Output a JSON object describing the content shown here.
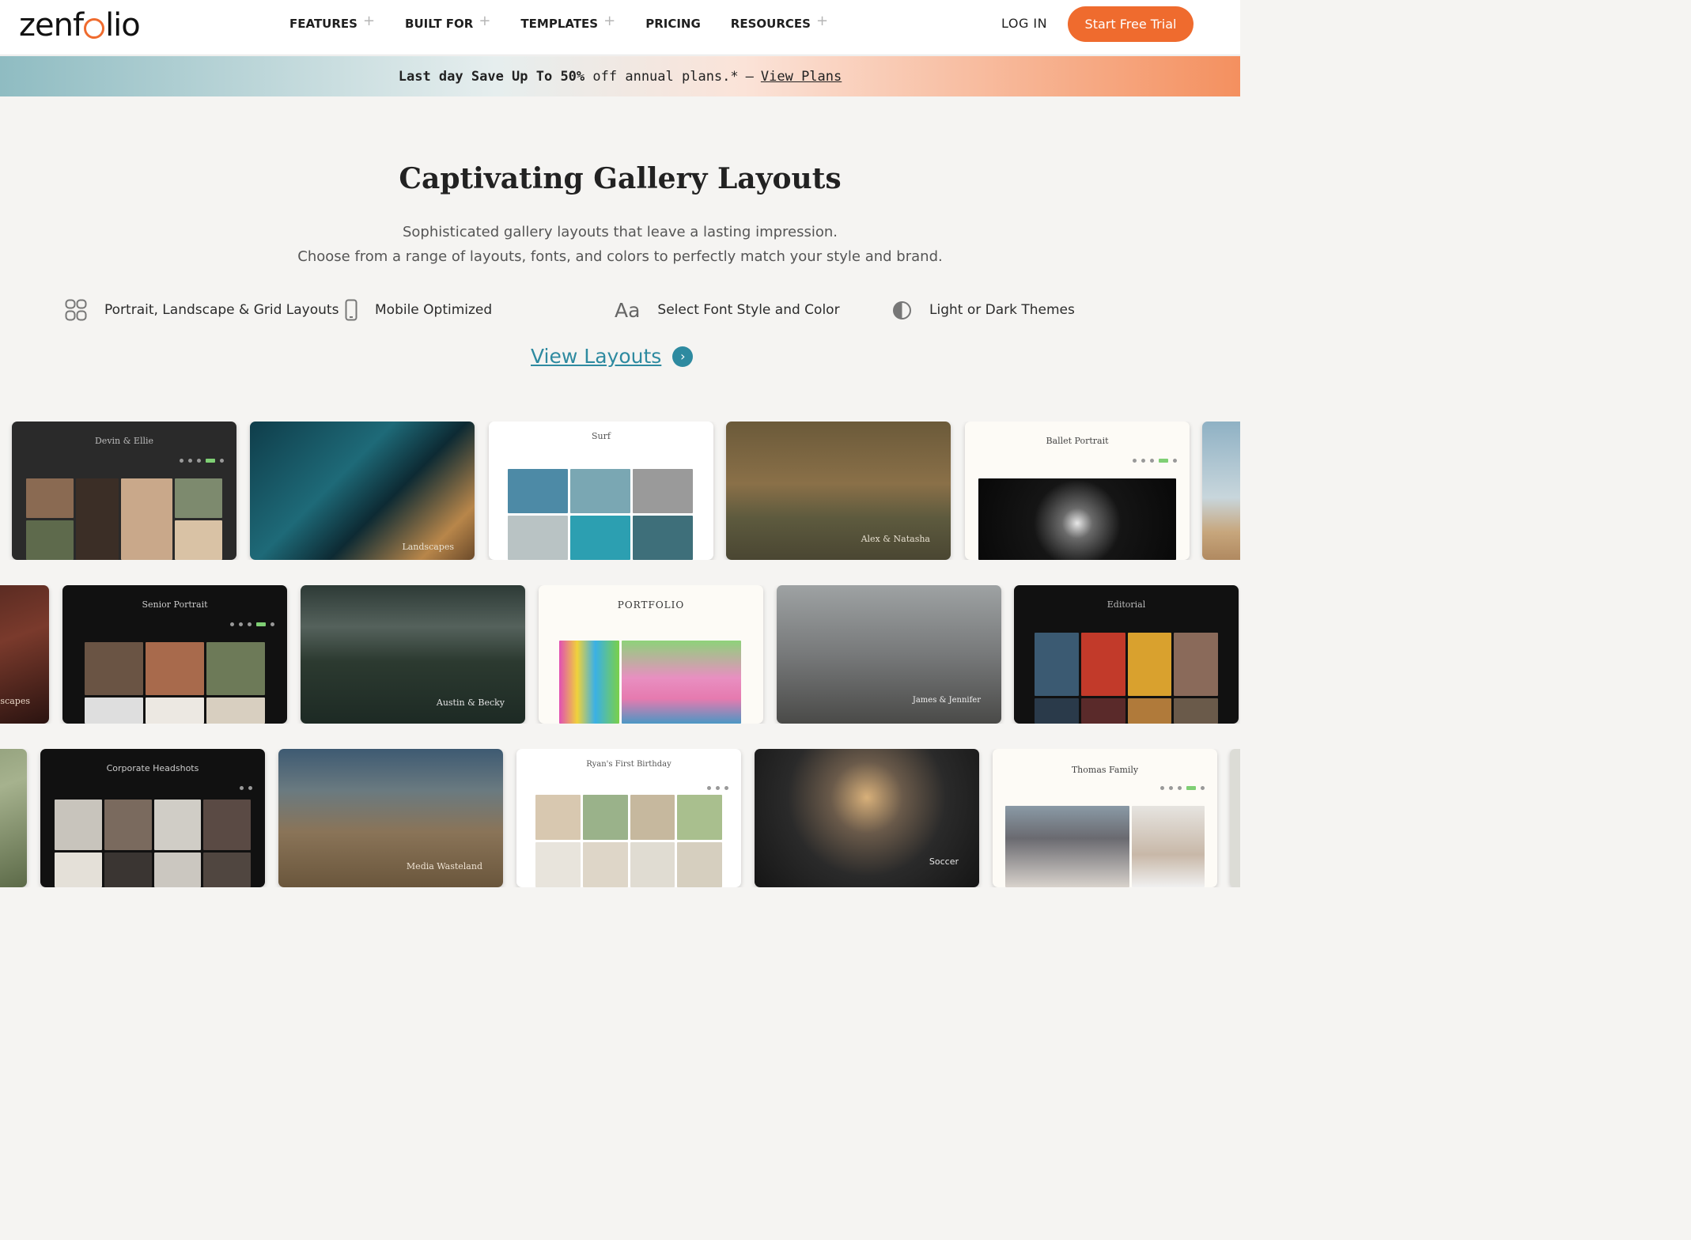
{
  "header": {
    "logo_text": "zenfolio",
    "nav": [
      {
        "label": "FEATURES",
        "has_plus": true
      },
      {
        "label": "BUILT FOR",
        "has_plus": true
      },
      {
        "label": "TEMPLATES",
        "has_plus": true
      },
      {
        "label": "PRICING",
        "has_plus": false
      },
      {
        "label": "RESOURCES",
        "has_plus": true
      }
    ],
    "plus_glyph": "+",
    "login_label": "LOG IN",
    "trial_label": "Start Free Trial",
    "accent_color": "#ef6b2e"
  },
  "promo": {
    "bold_text": "Last day Save Up To 50%",
    "rest_text": "off annual plans.*",
    "separator": "—",
    "link_text": "View Plans"
  },
  "hero": {
    "title": "Captivating Gallery Layouts",
    "subtitle_line1": "Sophisticated gallery layouts that leave a lasting impression.",
    "subtitle_line2": "Choose from a range of layouts, fonts, and colors to perfectly match your style and brand."
  },
  "features": [
    {
      "icon": "grid-layout-icon",
      "label": "Portrait, Landscape & Grid Layouts"
    },
    {
      "icon": "mobile-phone-icon",
      "label": "Mobile Optimized"
    },
    {
      "icon": "font-aa-icon",
      "glyph": "Aa",
      "label": "Select Font Style and Color"
    },
    {
      "icon": "half-circle-theme-icon",
      "label": "Light or Dark Themes"
    }
  ],
  "view_layouts": {
    "label": "View Layouts",
    "arrow": "›",
    "color": "#2e8aa0"
  },
  "gallery": {
    "row1": [
      {
        "title": "Devin & Ellie"
      },
      {
        "title": "Landscapes"
      },
      {
        "title": "Surf"
      },
      {
        "title": "Alex & Natasha"
      },
      {
        "title": "Ballet Portrait"
      }
    ],
    "row2": [
      {
        "title": "dscapes"
      },
      {
        "title": "Senior Portrait"
      },
      {
        "title": "Austin & Becky"
      },
      {
        "title": "PORTFOLIO"
      },
      {
        "title": "James & Jennifer"
      },
      {
        "title": "Editorial"
      }
    ],
    "row3": [
      {
        "title": "Corporate Headshots"
      },
      {
        "title": "Media Wasteland"
      },
      {
        "title": "Ryan's First Birthday"
      },
      {
        "title": "Soccer"
      },
      {
        "title": "Thomas Family"
      }
    ]
  }
}
